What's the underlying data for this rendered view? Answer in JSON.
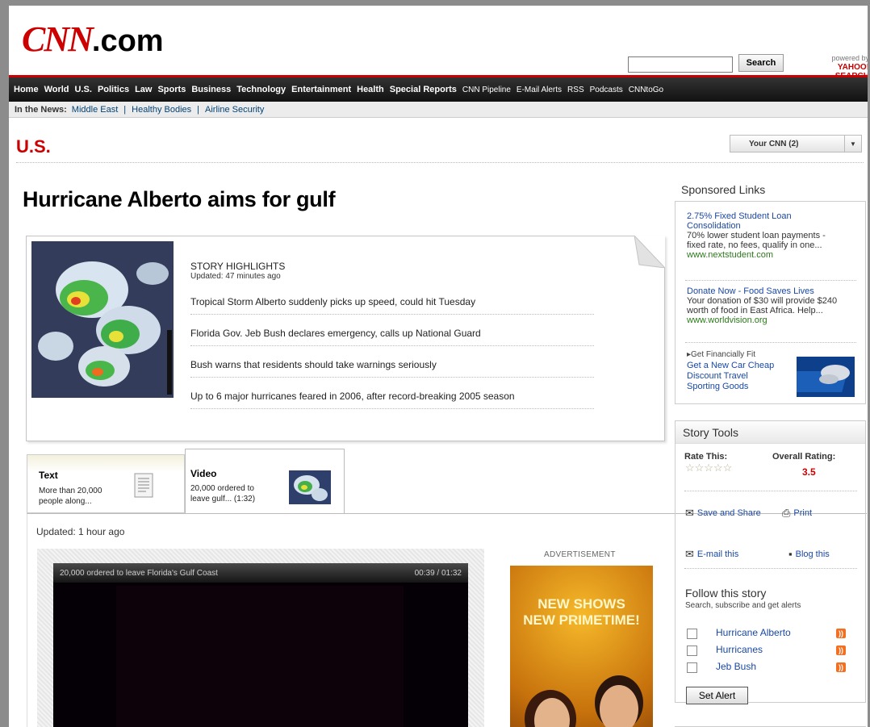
{
  "header": {
    "logo_cnn": "CNN",
    "logo_dotcom": ".com",
    "search_value": "",
    "search_button": "Search",
    "powered_by": "powered by",
    "powered_brand": "YAHOO! SEARCH"
  },
  "nav": {
    "items": [
      "Home",
      "World",
      "U.S.",
      "Politics",
      "Law",
      "Sports",
      "Business",
      "Technology",
      "Entertainment",
      "Health",
      "Special Reports"
    ],
    "light_items": [
      "CNN Pipeline",
      "E-Mail Alerts",
      "RSS",
      "Podcasts",
      "CNNtoGo"
    ]
  },
  "in_the_news": {
    "label": "In the News:",
    "links": [
      "Middle East",
      "Healthy Bodies",
      "Airline Security"
    ],
    "separator": "|"
  },
  "section": {
    "title": "U.S.",
    "your_cnn": "Your CNN (2)"
  },
  "article": {
    "headline": "Hurricane Alberto aims for gulf",
    "highlights_title": "STORY HIGHLIGHTS",
    "highlights_updated": "Updated: 47 minutes ago",
    "highlights": [
      "Tropical Storm Alberto suddenly picks up speed, could hit Tuesday",
      "Florida Gov. Jeb Bush declares emergency, calls up National Guard",
      "Bush warns that residents should take warnings seriously",
      "Up to 6 major hurricanes feared in 2006, after record-breaking 2005 season"
    ],
    "updated": "Updated: 1 hour ago"
  },
  "tabs": {
    "text": {
      "title": "Text",
      "desc1": "More than 20,000",
      "desc2": "people along..."
    },
    "video": {
      "title": "Video",
      "desc1": "20,000 ordered to",
      "desc2": "leave gulf... (1:32)"
    }
  },
  "player": {
    "title": "20,000 ordered to leave Florida's Gulf Coast",
    "time": "00:39 / 01:32"
  },
  "advertisement": {
    "label": "ADVERTISEMENT",
    "line1": "NEW SHOWS",
    "line2": "NEW PRIMETIME!"
  },
  "sponsored": {
    "title": "Sponsored Links",
    "items": [
      {
        "t1": "2.75% Fixed Student Loan",
        "t2": "Consolidation",
        "d1": "70% lower student loan payments -",
        "d2": "fixed rate, no fees, qualify in one...",
        "url": "www.nextstudent.com"
      },
      {
        "t1": "Donate Now - Food Saves Lives",
        "t2": "",
        "d1": "Your donation of $30 will provide $240",
        "d2": "worth of food in East Africa. Help...",
        "url": "www.worldvision.org"
      }
    ],
    "get_financially_fit": "Get Financially Fit",
    "fin_links": [
      "Get a New Car Cheap",
      "Discount Travel",
      "Sporting Goods"
    ]
  },
  "story_tools": {
    "title": "Story Tools",
    "rate_this": "Rate This:",
    "stars": "☆☆☆☆☆",
    "overall_label": "Overall Rating:",
    "overall_value": "3.5",
    "save_share": "Save and Share",
    "print": "Print",
    "email": "E-mail this",
    "blog": "Blog this",
    "follow_title": "Follow this story",
    "follow_sub": "Search, subscribe and get alerts",
    "follow_items": [
      "Hurricane Alberto",
      "Hurricanes",
      "Jeb Bush"
    ],
    "set_alert": "Set Alert"
  },
  "colors": {
    "brand_red": "#cc0000",
    "link_blue": "#1a48a5",
    "url_green": "#2a7a19"
  }
}
